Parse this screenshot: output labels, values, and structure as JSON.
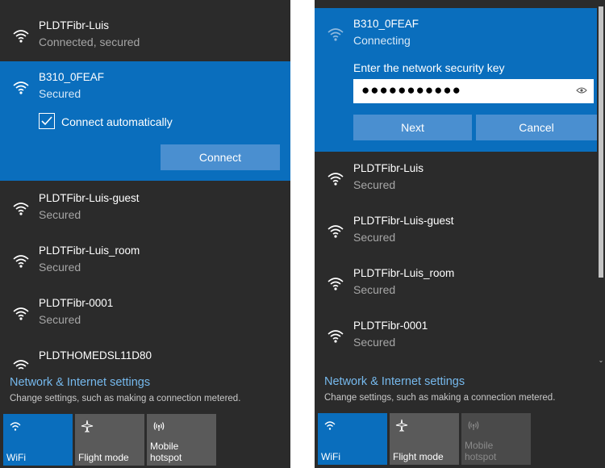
{
  "colors": {
    "panel_bg": "#2b2b2b",
    "accent": "#0a6ebd",
    "button": "#4a8fd0",
    "link": "#76b9ed",
    "muted": "#a6a6a6"
  },
  "left_panel": {
    "connected": {
      "name": "PLDTFibr-Luis",
      "status": "Connected, secured",
      "icon": "wifi-signal-icon"
    },
    "selected": {
      "name": "B310_0FEAF",
      "status": "Secured",
      "icon": "wifi-secured-icon",
      "auto_connect_label": "Connect automatically",
      "auto_connect_checked": true,
      "connect_label": "Connect"
    },
    "networks": [
      {
        "name": "PLDTFibr-Luis-guest",
        "status": "Secured"
      },
      {
        "name": "PLDTFibr-Luis_room",
        "status": "Secured"
      },
      {
        "name": "PLDTFibr-0001",
        "status": "Secured"
      },
      {
        "name": "PLDTHOMEDSL11D80",
        "status": ""
      }
    ],
    "settings_link": "Network & Internet settings",
    "settings_desc": "Change settings, such as making a connection metered.",
    "tiles": [
      {
        "label": "WiFi",
        "icon": "wifi-icon",
        "state": "on"
      },
      {
        "label": "Flight mode",
        "icon": "airplane-icon",
        "state": "off"
      },
      {
        "label": "Mobile\nhotspot",
        "icon": "hotspot-icon",
        "state": "off"
      }
    ]
  },
  "right_panel": {
    "selected": {
      "name": "B310_0FEAF",
      "status": "Connecting",
      "key_label": "Enter the network security key",
      "password_mask": "●●●●●●●●●●●",
      "next_label": "Next",
      "cancel_label": "Cancel"
    },
    "networks": [
      {
        "name": "PLDTFibr-Luis",
        "status": "Secured"
      },
      {
        "name": "PLDTFibr-Luis-guest",
        "status": "Secured"
      },
      {
        "name": "PLDTFibr-Luis_room",
        "status": "Secured"
      },
      {
        "name": "PLDTFibr-0001",
        "status": "Secured"
      }
    ],
    "settings_link": "Network & Internet settings",
    "settings_desc": "Change settings, such as making a connection metered.",
    "tiles": [
      {
        "label": "WiFi",
        "icon": "wifi-icon",
        "state": "on"
      },
      {
        "label": "Flight mode",
        "icon": "airplane-icon",
        "state": "off"
      },
      {
        "label": "Mobile\nhotspot",
        "icon": "hotspot-icon",
        "state": "disabled"
      }
    ],
    "scroll_arrow": "⌄"
  }
}
